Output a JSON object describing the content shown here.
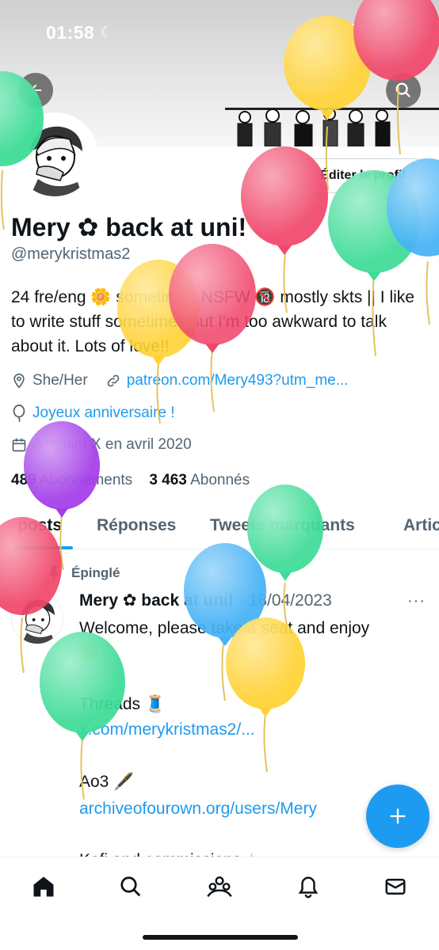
{
  "status_bar": {
    "time": "01:58"
  },
  "profile": {
    "edit_button": "Éditer le profil",
    "name": "Mery ✿ back at uni!",
    "handle": "@merykristmas2",
    "bio": "24 fre/eng 🌼 sometimes NSFW 🔞 mostly skts || I like to write stuff sometimes but I'm too awkward to talk about it. Lots of love!!",
    "pronouns": "She/Her",
    "website": "patreon.com/Mery493?utm_me...",
    "birthday": "Joyeux anniversaire !",
    "joined": "A rejoint X en avril 2020",
    "following_count": "489",
    "following_label": "Abonnements",
    "followers_count": "3 463",
    "followers_label": "Abonnés"
  },
  "tabs": [
    {
      "label": "posts"
    },
    {
      "label": "Réponses"
    },
    {
      "label": "Tweets marquants"
    },
    {
      "label": "Artic"
    }
  ],
  "tweet": {
    "pinned_label": "Épinglé",
    "author": "Mery ✿ back at uni!",
    "date": "· 18/04/2023",
    "more": "···",
    "lines": [
      "Welcome, please take a seat and enjoy",
      "🌼",
      "Threads 🧵",
      "x.com/merykristmas2/...",
      "Ao3 🖋️",
      "archiveofourown.org/users/Mery",
      "Kofi and commissions ☕"
    ]
  },
  "icons": {
    "back": "arrow-left-icon",
    "search": "search-icon",
    "fab": "plus-icon",
    "nav": [
      "home-icon",
      "search-icon",
      "communities-icon",
      "bell-icon",
      "mail-icon"
    ]
  },
  "colors": {
    "accent": "#1d9bf0",
    "text": "#0f1419",
    "secondary": "#536471",
    "balloon_green": "#3ddc97",
    "balloon_yellow": "#ffd233",
    "balloon_red": "#f0476b",
    "balloon_blue": "#45b1f5",
    "balloon_purple": "#a43ce8"
  }
}
